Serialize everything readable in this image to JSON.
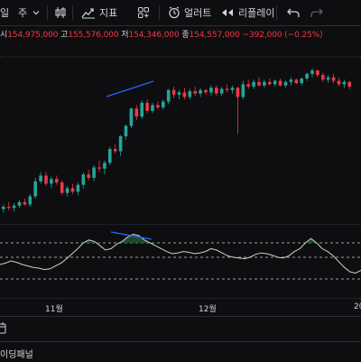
{
  "toolbar": {
    "interval_partial": "일",
    "interval_option": "주",
    "indicators_label": "지표",
    "alerts_label": "얼러트",
    "replay_label": "리플레이"
  },
  "ohlc": {
    "open_label": "시",
    "open_value": "154,975,000",
    "high_label": "고",
    "high_value": "155,576,000",
    "low_label": "저",
    "low_value": "154,346,000",
    "close_label": "종",
    "close_value": "154,557,000",
    "change": "−392,000 (−0.25%)"
  },
  "x_axis": {
    "labels": [
      "11월",
      "12월",
      "20"
    ]
  },
  "footer": {
    "panel_label": "이딩패널"
  },
  "colors": {
    "up": "#26a69a",
    "down": "#f23645",
    "background": "#0e0e10",
    "trendline": "#2962ff",
    "oscillator_fill": "#1f4a2a",
    "oscillator_line": "#c8d3cc"
  },
  "chart_data": {
    "type": "candlestick",
    "candles": [
      {
        "o": 20,
        "h": 24,
        "l": 17,
        "c": 22
      },
      {
        "o": 22,
        "h": 26,
        "l": 19,
        "c": 21
      },
      {
        "o": 21,
        "h": 25,
        "l": 18,
        "c": 23
      },
      {
        "o": 23,
        "h": 28,
        "l": 21,
        "c": 26
      },
      {
        "o": 26,
        "h": 29,
        "l": 23,
        "c": 24
      },
      {
        "o": 24,
        "h": 33,
        "l": 22,
        "c": 31
      },
      {
        "o": 31,
        "h": 47,
        "l": 29,
        "c": 44
      },
      {
        "o": 44,
        "h": 52,
        "l": 42,
        "c": 49
      },
      {
        "o": 49,
        "h": 52,
        "l": 40,
        "c": 42
      },
      {
        "o": 42,
        "h": 48,
        "l": 38,
        "c": 46
      },
      {
        "o": 46,
        "h": 49,
        "l": 41,
        "c": 43
      },
      {
        "o": 43,
        "h": 45,
        "l": 32,
        "c": 34
      },
      {
        "o": 34,
        "h": 40,
        "l": 31,
        "c": 38
      },
      {
        "o": 38,
        "h": 42,
        "l": 33,
        "c": 35
      },
      {
        "o": 35,
        "h": 43,
        "l": 32,
        "c": 41
      },
      {
        "o": 41,
        "h": 52,
        "l": 38,
        "c": 50
      },
      {
        "o": 50,
        "h": 54,
        "l": 45,
        "c": 47
      },
      {
        "o": 47,
        "h": 58,
        "l": 44,
        "c": 56
      },
      {
        "o": 56,
        "h": 62,
        "l": 52,
        "c": 55
      },
      {
        "o": 55,
        "h": 62,
        "l": 50,
        "c": 60
      },
      {
        "o": 60,
        "h": 74,
        "l": 58,
        "c": 72
      },
      {
        "o": 72,
        "h": 76,
        "l": 68,
        "c": 70
      },
      {
        "o": 70,
        "h": 84,
        "l": 66,
        "c": 83
      },
      {
        "o": 83,
        "h": 93,
        "l": 80,
        "c": 92
      },
      {
        "o": 92,
        "h": 108,
        "l": 90,
        "c": 107
      },
      {
        "o": 107,
        "h": 110,
        "l": 97,
        "c": 100
      },
      {
        "o": 100,
        "h": 114,
        "l": 98,
        "c": 112
      },
      {
        "o": 112,
        "h": 115,
        "l": 103,
        "c": 105
      },
      {
        "o": 105,
        "h": 112,
        "l": 103,
        "c": 110
      },
      {
        "o": 110,
        "h": 113,
        "l": 106,
        "c": 108
      },
      {
        "o": 108,
        "h": 115,
        "l": 106,
        "c": 113
      },
      {
        "o": 113,
        "h": 124,
        "l": 111,
        "c": 123
      },
      {
        "o": 123,
        "h": 126,
        "l": 116,
        "c": 119
      },
      {
        "o": 119,
        "h": 123,
        "l": 115,
        "c": 121
      },
      {
        "o": 121,
        "h": 125,
        "l": 115,
        "c": 117
      },
      {
        "o": 117,
        "h": 124,
        "l": 115,
        "c": 122
      },
      {
        "o": 122,
        "h": 126,
        "l": 118,
        "c": 120
      },
      {
        "o": 120,
        "h": 125,
        "l": 117,
        "c": 123
      },
      {
        "o": 123,
        "h": 124,
        "l": 119,
        "c": 121
      },
      {
        "o": 121,
        "h": 127,
        "l": 118,
        "c": 125
      },
      {
        "o": 125,
        "h": 127,
        "l": 118,
        "c": 120
      },
      {
        "o": 120,
        "h": 126,
        "l": 118,
        "c": 124
      },
      {
        "o": 124,
        "h": 128,
        "l": 121,
        "c": 123
      },
      {
        "o": 123,
        "h": 127,
        "l": 120,
        "c": 125
      },
      {
        "o": 125,
        "h": 126,
        "l": 85,
        "c": 117
      },
      {
        "o": 117,
        "h": 131,
        "l": 115,
        "c": 128
      },
      {
        "o": 128,
        "h": 132,
        "l": 124,
        "c": 126
      },
      {
        "o": 126,
        "h": 132,
        "l": 124,
        "c": 130
      },
      {
        "o": 130,
        "h": 134,
        "l": 126,
        "c": 127
      },
      {
        "o": 127,
        "h": 132,
        "l": 125,
        "c": 130
      },
      {
        "o": 130,
        "h": 133,
        "l": 127,
        "c": 128
      },
      {
        "o": 128,
        "h": 132,
        "l": 126,
        "c": 131
      },
      {
        "o": 131,
        "h": 133,
        "l": 126,
        "c": 127
      },
      {
        "o": 127,
        "h": 131,
        "l": 125,
        "c": 130
      },
      {
        "o": 130,
        "h": 134,
        "l": 127,
        "c": 132
      },
      {
        "o": 132,
        "h": 133,
        "l": 128,
        "c": 129
      },
      {
        "o": 129,
        "h": 134,
        "l": 127,
        "c": 133
      },
      {
        "o": 133,
        "h": 138,
        "l": 131,
        "c": 137
      },
      {
        "o": 137,
        "h": 142,
        "l": 134,
        "c": 140
      },
      {
        "o": 140,
        "h": 141,
        "l": 134,
        "c": 136
      },
      {
        "o": 136,
        "h": 138,
        "l": 130,
        "c": 132
      },
      {
        "o": 132,
        "h": 136,
        "l": 129,
        "c": 134
      },
      {
        "o": 134,
        "h": 137,
        "l": 129,
        "c": 131
      },
      {
        "o": 131,
        "h": 134,
        "l": 126,
        "c": 128
      },
      {
        "o": 128,
        "h": 132,
        "l": 125,
        "c": 130
      },
      {
        "o": 130,
        "h": 131,
        "l": 124,
        "c": 126
      }
    ],
    "oscillator": [
      40,
      42,
      45,
      43,
      40,
      38,
      36,
      35,
      33,
      34,
      38,
      42,
      48,
      55,
      62,
      70,
      74,
      72,
      66,
      60,
      62,
      68,
      72,
      78,
      82,
      80,
      74,
      70,
      66,
      62,
      58,
      55,
      56,
      58,
      57,
      55,
      56,
      58,
      62,
      60,
      56,
      52,
      50,
      49,
      48,
      50,
      54,
      56,
      55,
      53,
      50,
      49,
      52,
      58,
      62,
      70,
      76,
      70,
      62,
      58,
      52,
      44,
      36,
      30,
      28,
      32
    ],
    "osc_levels": [
      70,
      50,
      20
    ]
  }
}
